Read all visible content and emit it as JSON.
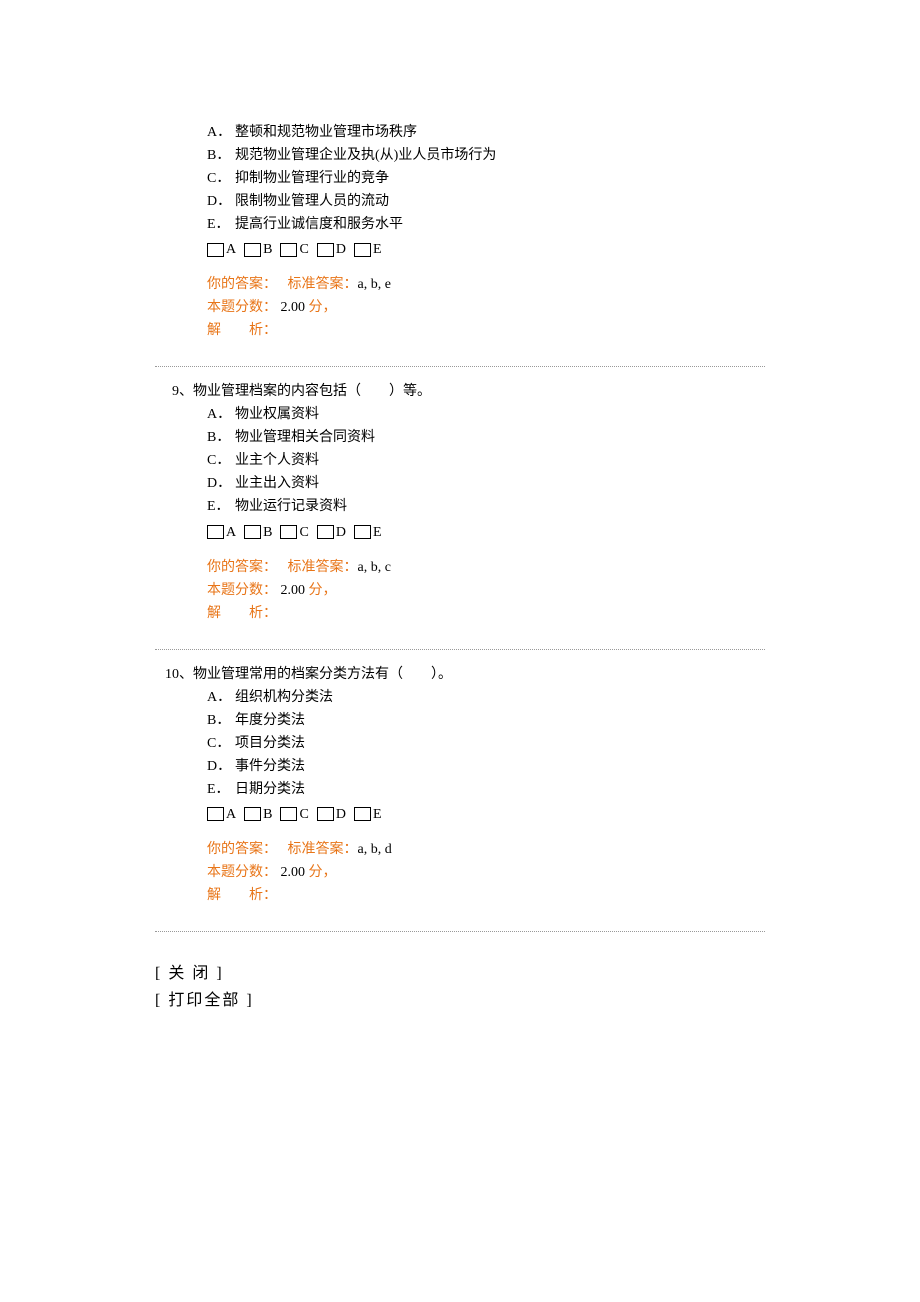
{
  "questions": [
    {
      "number": "",
      "stem": "",
      "options": [
        {
          "letter": "A．",
          "text": "整顿和规范物业管理市场秩序"
        },
        {
          "letter": "B．",
          "text": "规范物业管理企业及执(从)业人员市场行为"
        },
        {
          "letter": "C．",
          "text": "抑制物业管理行业的竞争"
        },
        {
          "letter": "D．",
          "text": "限制物业管理人员的流动"
        },
        {
          "letter": "E．",
          "text": "提高行业诚信度和服务水平"
        }
      ],
      "checkbox_labels": [
        "A",
        "B",
        "C",
        "D",
        "E"
      ],
      "your_answer_label": "你的答案：",
      "standard_answer_label": "标准答案：",
      "standard_answer": "a, b, e",
      "score_label": "本题分数：",
      "score_value": "2.00",
      "score_unit": "分，",
      "analysis_label": "解　　析："
    },
    {
      "number": "9、",
      "stem": "物业管理档案的内容包括（　　）等。",
      "options": [
        {
          "letter": "A．",
          "text": "物业权属资料"
        },
        {
          "letter": "B．",
          "text": "物业管理相关合同资料"
        },
        {
          "letter": "C．",
          "text": "业主个人资料"
        },
        {
          "letter": "D．",
          "text": "业主出入资料"
        },
        {
          "letter": "E．",
          "text": "物业运行记录资料"
        }
      ],
      "checkbox_labels": [
        "A",
        "B",
        "C",
        "D",
        "E"
      ],
      "your_answer_label": "你的答案：",
      "standard_answer_label": "标准答案：",
      "standard_answer": "a, b, c",
      "score_label": "本题分数：",
      "score_value": "2.00",
      "score_unit": "分，",
      "analysis_label": "解　　析："
    },
    {
      "number": "10、",
      "stem": "物业管理常用的档案分类方法有（　　）。",
      "options": [
        {
          "letter": "A．",
          "text": "组织机构分类法"
        },
        {
          "letter": "B．",
          "text": "年度分类法"
        },
        {
          "letter": "C．",
          "text": "项目分类法"
        },
        {
          "letter": "D．",
          "text": "事件分类法"
        },
        {
          "letter": "E．",
          "text": "日期分类法"
        }
      ],
      "checkbox_labels": [
        "A",
        "B",
        "C",
        "D",
        "E"
      ],
      "your_answer_label": "你的答案：",
      "standard_answer_label": "标准答案：",
      "standard_answer": "a, b, d",
      "score_label": "本题分数：",
      "score_value": "2.00",
      "score_unit": "分，",
      "analysis_label": "解　　析："
    }
  ],
  "footer": {
    "close": "[ 关 闭 ]",
    "print_all": "[ 打印全部 ]"
  }
}
